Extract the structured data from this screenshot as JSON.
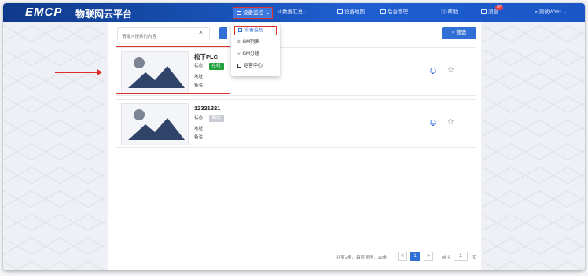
{
  "header": {
    "logo": "EMCP",
    "platform_title": "物联网云平台",
    "nav": {
      "device_monitor": "设备监控",
      "data_summary": "数据汇总",
      "device_map": "设备地图",
      "backend": "后台管理",
      "help": "帮助",
      "messages": "消息",
      "message_count": "37",
      "user": "测试WYH"
    }
  },
  "dropdown": {
    "items": [
      "设备监控",
      "GM列表",
      "GM分组",
      "运营中心"
    ]
  },
  "toolbar": {
    "search_placeholder": "请输入搜索的内容",
    "clear_icon": "×",
    "filter_label": "筛选"
  },
  "devices": [
    {
      "name": "松下PLC",
      "status_label": "状态：",
      "status": "在线",
      "address_label": "地址：",
      "address": "",
      "note_label": "备注：",
      "note": ""
    },
    {
      "name": "12321321",
      "status_label": "状态：",
      "status": "离线",
      "address_label": "地址：",
      "address": "",
      "note_label": "备注：",
      "note": ""
    }
  ],
  "pagination": {
    "summary": "共有2条，每页显示：10条",
    "prev": "<",
    "current": "1",
    "next": ">",
    "goto_label": "前往",
    "goto_value": "1",
    "page_suffix": "页"
  },
  "colors": {
    "accent": "#2f6fd6",
    "online": "#1fa23c",
    "offline": "#c9ccd3",
    "annotation": "#e0302a",
    "header": "#1a56c6"
  }
}
